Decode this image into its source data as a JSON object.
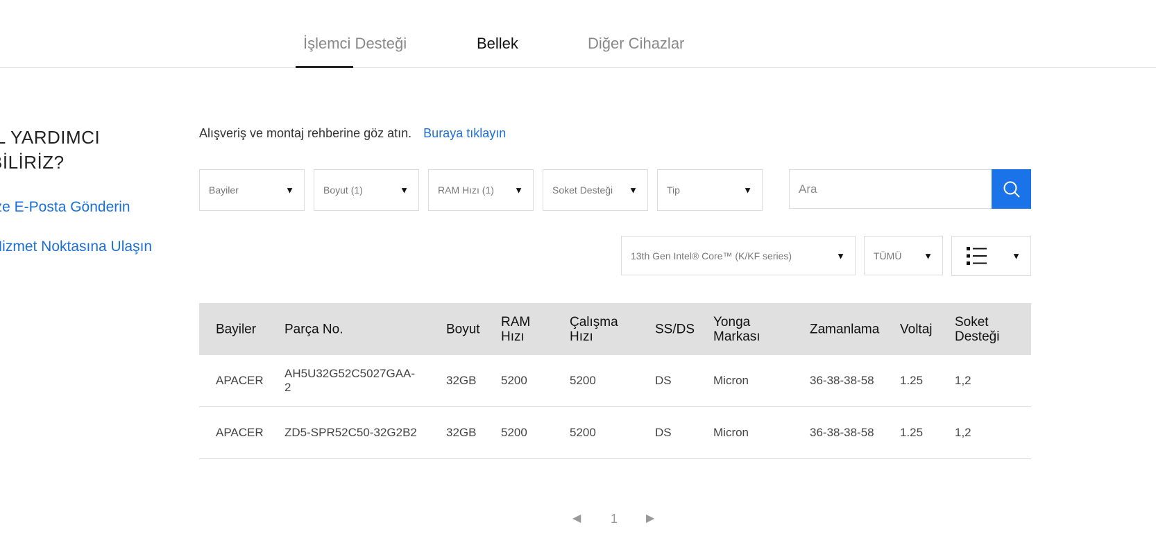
{
  "tabs": [
    {
      "label": "İşlemci Desteği"
    },
    {
      "label": "Bellek"
    },
    {
      "label": "Diğer Cihazlar"
    }
  ],
  "help": {
    "title_line1": "IL YARDIMCI",
    "title_line2": "BİLİRİZ?",
    "email_link": "ize E-Posta Gönderin",
    "service_link": "Hizmet Noktasına Ulaşın"
  },
  "guide": {
    "text": "Alışveriş ve montaj rehberine göz atın.",
    "link": "Buraya tıklayın"
  },
  "filters": {
    "vendors": "Bayiler",
    "size": "Boyut (1)",
    "ram_speed": "RAM Hızı (1)",
    "socket": "Soket Desteği",
    "type": "Tip",
    "cpu": "13th Gen Intel® Core™ (K/KF series)",
    "all": "TÜMÜ",
    "arrow": "▼"
  },
  "search": {
    "placeholder": "Ara"
  },
  "table": {
    "headers": {
      "vendor": "Bayiler",
      "part_no": "Parça No.",
      "size": "Boyut",
      "ram_1": "RAM",
      "ram_2": "Hızı",
      "op_1": "Çalışma",
      "op_2": "Hızı",
      "ssds": "SS/DS",
      "chip_1": "Yonga",
      "chip_2": "Markası",
      "timing": "Zamanlama",
      "voltage": "Voltaj",
      "socket_1": "Soket",
      "socket_2": "Desteği"
    },
    "rows": [
      {
        "vendor": "APACER",
        "part_1": "AH5U32G52C5027GAA-",
        "part_2": "2",
        "size": "32GB",
        "ram": "5200",
        "op": "5200",
        "ssds": "DS",
        "chip": "Micron",
        "timing": "36-38-38-58",
        "voltage": "1.25",
        "socket": "1,2"
      },
      {
        "vendor": "APACER",
        "part_1": "ZD5-SPR52C50-32G2B2",
        "part_2": "",
        "size": "32GB",
        "ram": "5200",
        "op": "5200",
        "ssds": "DS",
        "chip": "Micron",
        "timing": "36-38-38-58",
        "voltage": "1.25",
        "socket": "1,2"
      }
    ]
  },
  "pagination": {
    "prev": "◀",
    "page": "1",
    "next": "▶"
  },
  "colors": {
    "accent": "#1a73e8",
    "link": "#1a6fd6",
    "header_bg": "#e0e0e0"
  }
}
